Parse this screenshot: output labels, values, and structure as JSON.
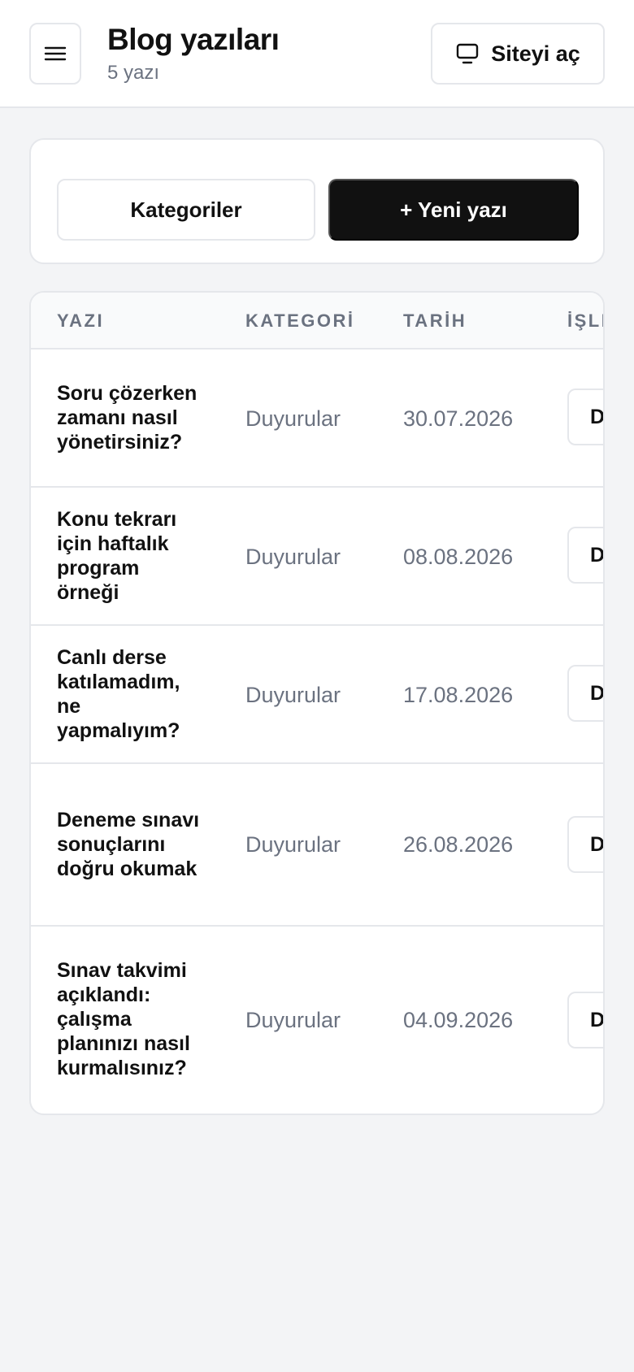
{
  "header": {
    "title": "Blog yazıları",
    "subtitle": "5 yazı",
    "open_site_label": "Siteyi aç",
    "menu_icon": "hamburger-menu-icon",
    "monitor_icon": "monitor-icon"
  },
  "actions": {
    "categories_label": "Kategoriler",
    "new_post_label": "+ Yeni yazı"
  },
  "table": {
    "columns": [
      "YAZI",
      "KATEGORİ",
      "TARİH",
      "İŞLEM"
    ],
    "rows": [
      {
        "title": "Soru çözerken zamanı nasıl yönetirsiniz?",
        "category": "Duyurular",
        "date": "30.07.2026",
        "action": "Düzenle"
      },
      {
        "title": "Konu tekrarı için haftalık program örneği",
        "category": "Duyurular",
        "date": "08.08.2026",
        "action": "Düzenle"
      },
      {
        "title": "Canlı derse katılamadım, ne yapmalıyım?",
        "category": "Duyurular",
        "date": "17.08.2026",
        "action": "Düzenle"
      },
      {
        "title": "Deneme sınavı sonuçlarını doğru okumak",
        "category": "Duyurular",
        "date": "26.08.2026",
        "action": "Düzenle"
      },
      {
        "title": "Sınav takvimi açıklandı: çalışma planınızı nasıl kurmalısınız?",
        "category": "Duyurular",
        "date": "04.09.2026",
        "action": "Düzenle"
      }
    ]
  },
  "colors": {
    "primary_button": "#111111",
    "muted_text": "#6b7280",
    "border": "#e5e7eb",
    "background": "#f3f4f6"
  }
}
